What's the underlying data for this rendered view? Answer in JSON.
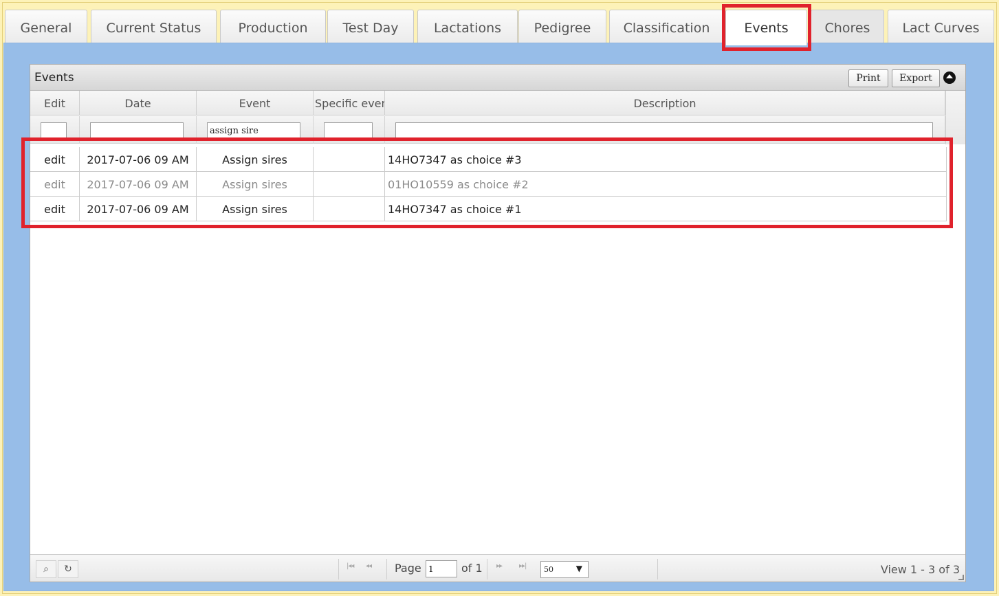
{
  "tabs": [
    {
      "label": "General"
    },
    {
      "label": "Current Status"
    },
    {
      "label": "Production"
    },
    {
      "label": "Test Day"
    },
    {
      "label": "Lactations"
    },
    {
      "label": "Pedigree"
    },
    {
      "label": "Classification"
    },
    {
      "label": "Events"
    },
    {
      "label": "Chores"
    },
    {
      "label": "Lact Curves"
    }
  ],
  "active_tab": "Events",
  "grid": {
    "title": "Events",
    "print_label": "Print",
    "export_label": "Export",
    "columns": [
      "Edit",
      "Date",
      "Event",
      "Specific event",
      "Description"
    ],
    "filters": {
      "edit": "",
      "date": "",
      "event": "assign sire",
      "specific": "",
      "description": ""
    },
    "rows": [
      {
        "edit": "edit",
        "date": "2017-07-06 09 AM",
        "event": "Assign sires",
        "specific": "",
        "description": "14HO7347 as choice #3"
      },
      {
        "edit": "edit",
        "date": "2017-07-06 09 AM",
        "event": "Assign sires",
        "specific": "",
        "description": "01HO10559 as choice #2"
      },
      {
        "edit": "edit",
        "date": "2017-07-06 09 AM",
        "event": "Assign sires",
        "specific": "",
        "description": "14HO7347 as choice #1"
      }
    ]
  },
  "pager": {
    "page_label": "Page",
    "page_value": "1",
    "of_label": "of 1",
    "page_size": "50",
    "view_text": "View 1 - 3 of 3"
  },
  "colors": {
    "highlight": "#e0222c",
    "content_bg": "#97bde8",
    "page_bg": "#fdf2b8"
  }
}
